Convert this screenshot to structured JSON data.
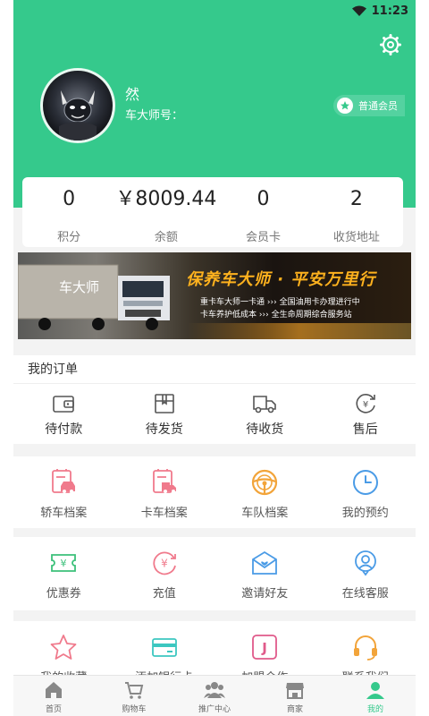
{
  "status_bar": {
    "time": "11:23"
  },
  "profile": {
    "name": "然",
    "id_label": "车大师号：",
    "member_badge": "普通会员"
  },
  "stats": [
    {
      "value": "0",
      "label": "积分"
    },
    {
      "value": "￥8009.44",
      "label": "余额"
    },
    {
      "value": "0",
      "label": "会员卡"
    },
    {
      "value": "2",
      "label": "收货地址"
    }
  ],
  "banner": {
    "logo_text": "车大师",
    "slogan": "保养车大师 · 平安万里行",
    "line1_left": "重卡车大师一卡通",
    "line1_right": "全国油用卡办理进行中",
    "line2_left": "卡车养护低成本",
    "line2_right": "全生命周期综合服务站"
  },
  "orders": {
    "title": "我的订单",
    "items": [
      {
        "label": "待付款",
        "icon": "wallet-icon"
      },
      {
        "label": "待发货",
        "icon": "box-icon"
      },
      {
        "label": "待收货",
        "icon": "truck-icon"
      },
      {
        "label": "售后",
        "icon": "refund-icon"
      }
    ]
  },
  "grid1": [
    {
      "label": "轿车档案",
      "icon": "car-file-icon"
    },
    {
      "label": "卡车档案",
      "icon": "truck-file-icon"
    },
    {
      "label": "车队档案",
      "icon": "steering-wheel-icon"
    },
    {
      "label": "我的预约",
      "icon": "clock-icon"
    }
  ],
  "grid2": [
    {
      "label": "优惠券",
      "icon": "coupon-icon"
    },
    {
      "label": "充值",
      "icon": "recharge-icon"
    },
    {
      "label": "邀请好友",
      "icon": "invite-icon"
    },
    {
      "label": "在线客服",
      "icon": "service-icon"
    }
  ],
  "grid3": [
    {
      "label": "我的收藏",
      "icon": "star-icon"
    },
    {
      "label": "添加银行卡",
      "icon": "bank-card-icon"
    },
    {
      "label": "加盟合作",
      "icon": "join-icon"
    },
    {
      "label": "联系我们",
      "icon": "headset-icon"
    }
  ],
  "tabs": [
    {
      "label": "首页",
      "icon": "home-icon"
    },
    {
      "label": "购物车",
      "icon": "cart-icon"
    },
    {
      "label": "推广中心",
      "icon": "people-icon"
    },
    {
      "label": "商家",
      "icon": "shop-icon"
    },
    {
      "label": "我的",
      "icon": "user-icon",
      "active": true
    }
  ],
  "colors": {
    "brand": "#35c98c",
    "pink": "#f07a8c",
    "orange": "#f2a43a",
    "blue": "#4a9be6",
    "green": "#3cc07a"
  }
}
